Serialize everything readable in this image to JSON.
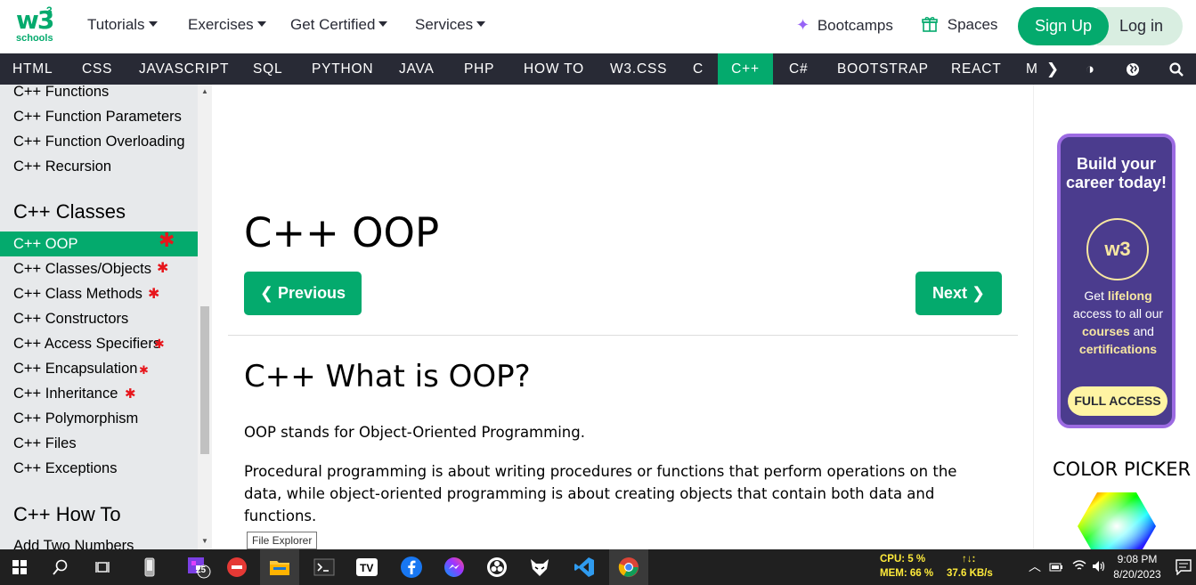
{
  "logo": {
    "text": "w3",
    "sup": "3",
    "schools": "schools"
  },
  "topnav": {
    "items": [
      "Tutorials",
      "Exercises",
      "Get Certified",
      "Services"
    ],
    "bootcamps": "Bootcamps",
    "spaces": "Spaces",
    "signup": "Sign Up",
    "login": "Log in"
  },
  "darknav": {
    "items": [
      "HTML",
      "CSS",
      "JAVASCRIPT",
      "SQL",
      "PYTHON",
      "JAVA",
      "PHP",
      "HOW TO",
      "W3.CSS",
      "C",
      "C++",
      "C#",
      "BOOTSTRAP",
      "REACT",
      "M"
    ],
    "active": "C++"
  },
  "sidebar": {
    "items_top": [
      "C++ Functions",
      "C++ Function Parameters",
      "C++ Function Overloading",
      "C++ Recursion"
    ],
    "section1": "C++ Classes",
    "classes": [
      "C++ OOP",
      "C++ Classes/Objects",
      "C++ Class Methods",
      "C++ Constructors",
      "C++ Access Specifiers",
      "C++ Encapsulation",
      "C++ Inheritance",
      "C++ Polymorphism",
      "C++ Files",
      "C++ Exceptions"
    ],
    "section2": "C++ How To",
    "howto": [
      "Add Two Numbers"
    ]
  },
  "main": {
    "title": "C++ OOP",
    "prev": "Previous",
    "next": "Next",
    "h2": "C++ What is OOP?",
    "p1": "OOP stands for Object-Oriented Programming.",
    "p2": "Procedural programming is about writing procedures or functions that perform operations on the data, while object-oriented programming is about creating objects that contain both data and functions."
  },
  "tooltip": "File Explorer",
  "ad": {
    "title": "Build your career today!",
    "badge": "w3",
    "body_get": "Get ",
    "body_lifelong": "lifelong",
    "body_access": " access to all our ",
    "body_courses": "courses",
    "body_and": " and ",
    "body_certs": "certifications",
    "cta": "FULL ACCESS"
  },
  "color_picker": "COLOR PICKER",
  "taskbar": {
    "badge": "25",
    "cpu": "CPU: 5 %",
    "mem": "MEM: 66 %",
    "net_icon": "↑↓:",
    "net_speed": "37.6 KB/s",
    "time": "9:08 PM",
    "date": "8/20/2023"
  },
  "colors": {
    "brand": "#04AA6D",
    "dark": "#282A35",
    "purple": "#4B3C8E"
  }
}
